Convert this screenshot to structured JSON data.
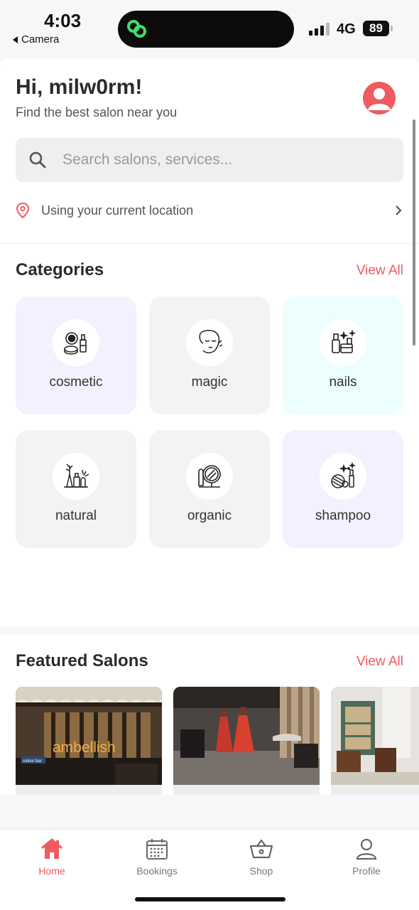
{
  "status_bar": {
    "time": "4:03",
    "back_label": "Camera",
    "network": "4G",
    "battery": "89"
  },
  "header": {
    "greeting": "Hi, milw0rm!",
    "subtitle": "Find the best salon near you"
  },
  "search": {
    "placeholder": "Search salons, services..."
  },
  "location": {
    "label": "Using your current location"
  },
  "categories": {
    "title": "Categories",
    "view_all": "View All",
    "items": [
      {
        "label": "cosmetic",
        "icon": "cosmetic-icon",
        "bg": "#f2f2fe"
      },
      {
        "label": "magic",
        "icon": "face-icon",
        "bg": "#f3f3f3"
      },
      {
        "label": "nails",
        "icon": "nail-polish-icon",
        "bg": "#ecfefd"
      },
      {
        "label": "natural",
        "icon": "natural-products-icon",
        "bg": "#f3f3f3"
      },
      {
        "label": "organic",
        "icon": "mirror-icon",
        "bg": "#f3f3f3"
      },
      {
        "label": "shampoo",
        "icon": "shampoo-icon",
        "bg": "#f2f2fe"
      }
    ]
  },
  "featured": {
    "title": "Featured Salons",
    "view_all": "View All",
    "salons": [
      {
        "sign_text": "ambellish",
        "board_text": "colour bar"
      },
      {
        "sign_text": ""
      },
      {
        "sign_text": ""
      }
    ]
  },
  "bottom_nav": {
    "items": [
      {
        "label": "Home",
        "icon": "home-icon",
        "active": true
      },
      {
        "label": "Bookings",
        "icon": "calendar-icon",
        "active": false
      },
      {
        "label": "Shop",
        "icon": "basket-icon",
        "active": false
      },
      {
        "label": "Profile",
        "icon": "person-icon",
        "active": false
      }
    ]
  },
  "colors": {
    "accent": "#ef5b60",
    "lavender": "#f2f2fe",
    "mint": "#ecfefd",
    "gray_tile": "#f3f3f3"
  }
}
